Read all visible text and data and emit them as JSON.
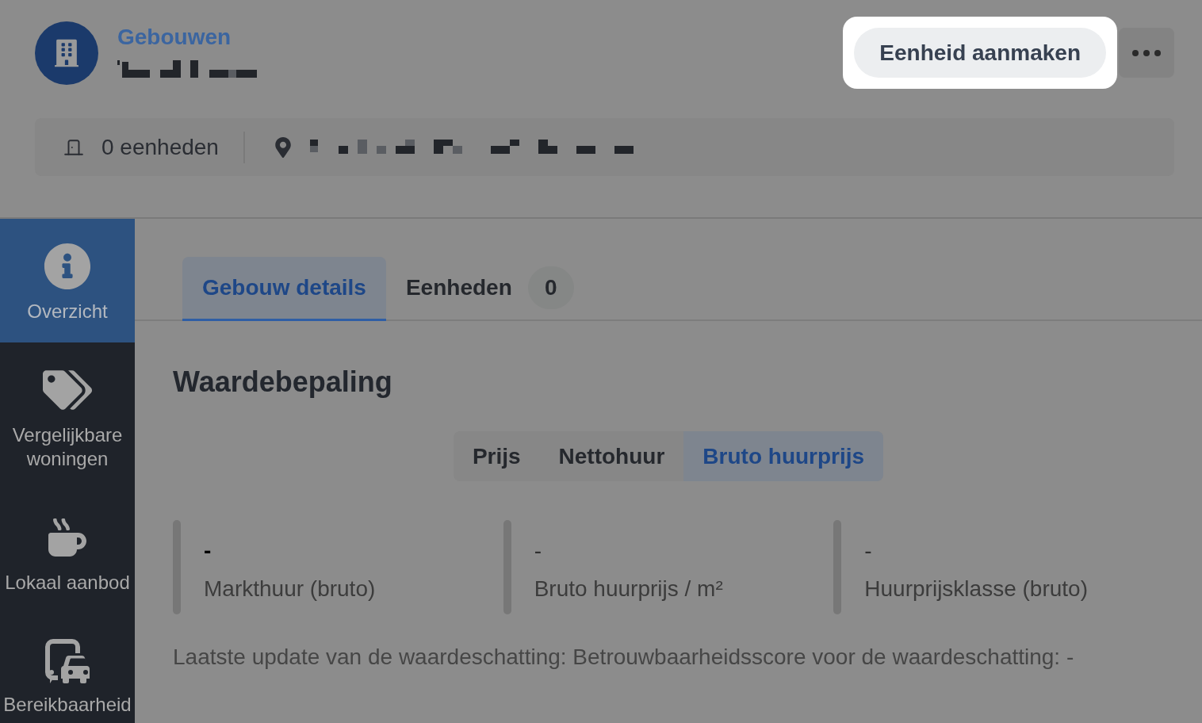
{
  "header": {
    "breadcrumb": "Gebouwen",
    "units": "0 eenheden",
    "primary_action": {
      "label": "Eenheid aanmaken",
      "highlighted": true
    }
  },
  "sidebar": {
    "items": [
      {
        "label": "Overzicht",
        "selected": true
      },
      {
        "label": "Vergelijkbare woningen",
        "selected": false
      },
      {
        "label": "Lokaal aanbod",
        "selected": false
      },
      {
        "label": "Bereikbaarheid",
        "selected": false
      }
    ]
  },
  "tabs": [
    {
      "label": "Gebouw details",
      "selected": true
    },
    {
      "label": "Eenheden",
      "count": "0",
      "selected": false
    }
  ],
  "valuation": {
    "title": "Waardebepaling",
    "modes": [
      {
        "label": "Prijs",
        "selected": false
      },
      {
        "label": "Nettohuur",
        "selected": false
      },
      {
        "label": "Bruto huurprijs",
        "selected": true
      }
    ],
    "metrics": [
      {
        "value": "-",
        "label": "Markthuur (bruto)",
        "emphasized": true
      },
      {
        "value": "-",
        "label": "Bruto huurprijs / m²",
        "emphasized": false
      },
      {
        "value": "-",
        "label": "Huurprijsklasse (bruto)",
        "emphasized": false
      }
    ],
    "footnote": "Laatste update van de waardeschatting: Betrouwbaarheidsscore voor de waardeschatting: -"
  }
}
